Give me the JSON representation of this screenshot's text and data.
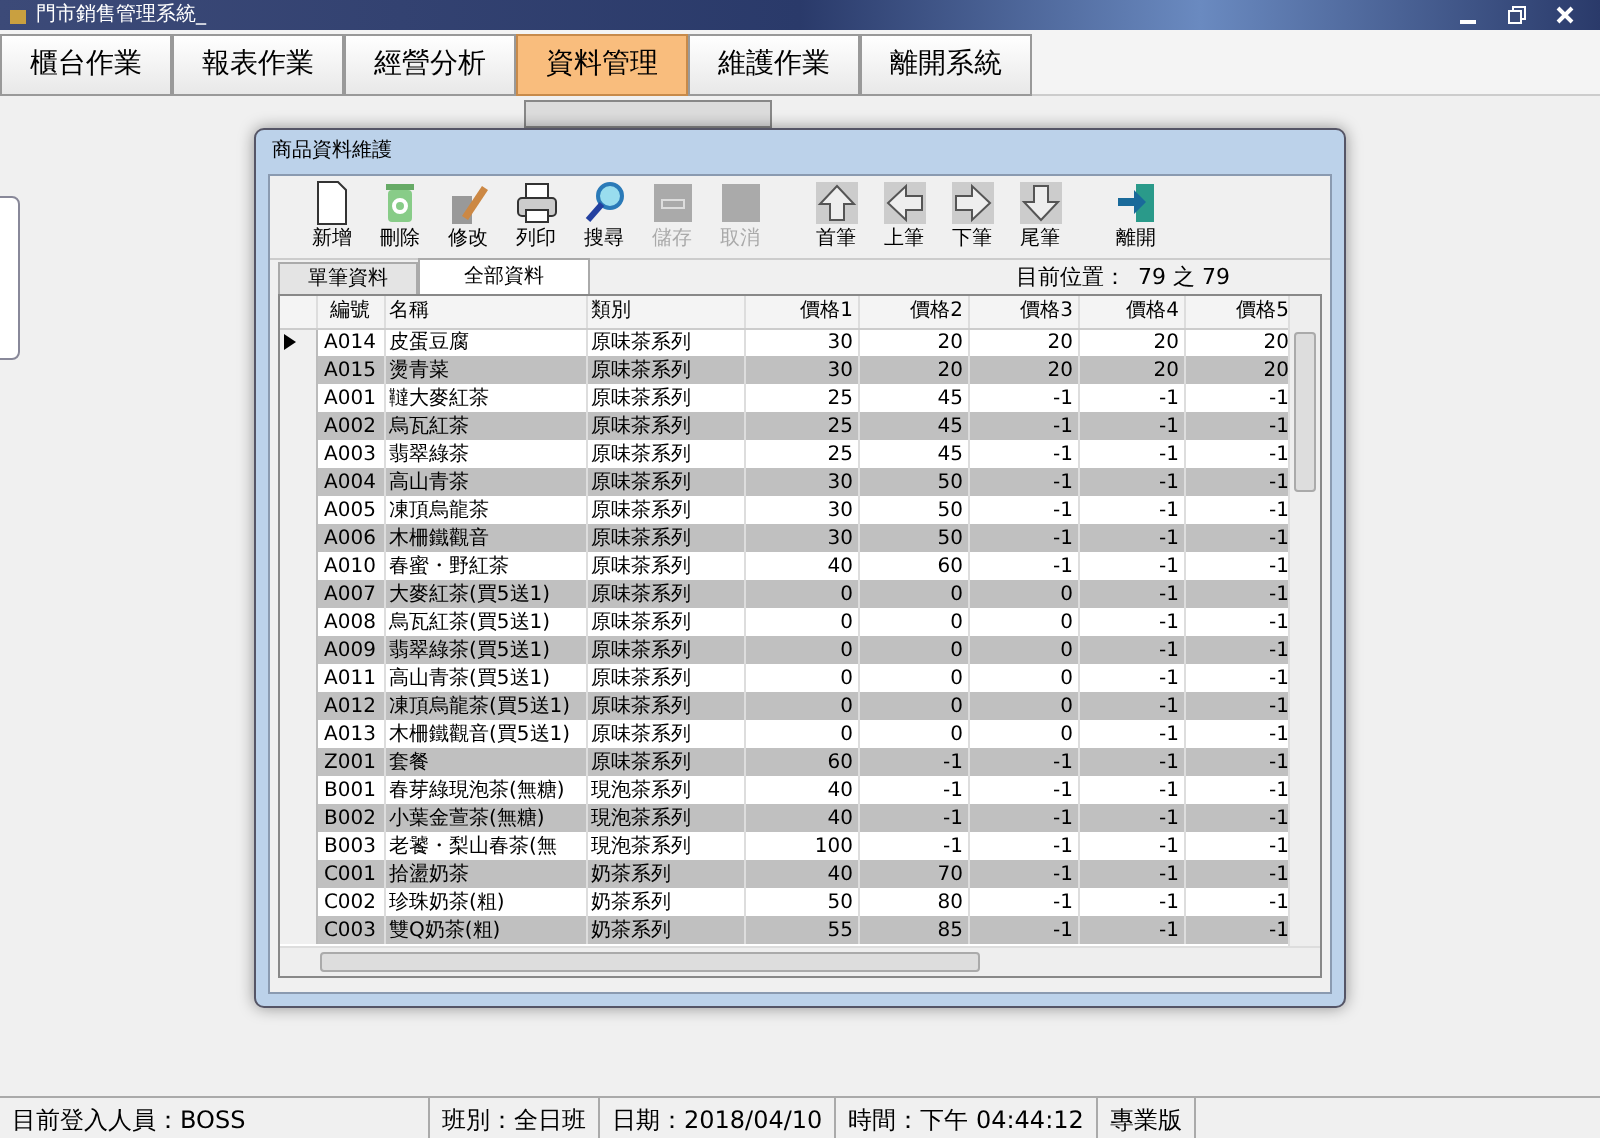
{
  "window": {
    "title": "門市銷售管理系統_"
  },
  "menu": [
    {
      "label": "櫃台作業",
      "selected": false
    },
    {
      "label": "報表作業",
      "selected": false
    },
    {
      "label": "經營分析",
      "selected": false
    },
    {
      "label": "資料管理",
      "selected": true
    },
    {
      "label": "維護作業",
      "selected": false
    },
    {
      "label": "離開系統",
      "selected": false
    }
  ],
  "dialog": {
    "title": "商品資料維護",
    "toolbar": [
      {
        "label": "新增",
        "kind": "new",
        "disabled": false
      },
      {
        "label": "刪除",
        "kind": "delete",
        "disabled": false
      },
      {
        "label": "修改",
        "kind": "edit",
        "disabled": false
      },
      {
        "label": "列印",
        "kind": "print",
        "disabled": false
      },
      {
        "label": "搜尋",
        "kind": "search",
        "disabled": false
      },
      {
        "label": "儲存",
        "kind": "save",
        "disabled": true
      },
      {
        "label": "取消",
        "kind": "cancel",
        "disabled": true
      },
      {
        "label": "首筆",
        "kind": "up",
        "disabled": false
      },
      {
        "label": "上筆",
        "kind": "left",
        "disabled": false
      },
      {
        "label": "下筆",
        "kind": "right",
        "disabled": false
      },
      {
        "label": "尾筆",
        "kind": "down",
        "disabled": false
      },
      {
        "label": "離開",
        "kind": "exit",
        "disabled": false
      }
    ],
    "tabs": [
      {
        "label": "單筆資料",
        "selected": false
      },
      {
        "label": "全部資料",
        "selected": true
      }
    ],
    "position_label": "目前位置：",
    "position": "79 之 79",
    "table": {
      "columns": [
        "編號",
        "名稱",
        "類別",
        "價格1",
        "價格2",
        "價格3",
        "價格4",
        "價格5"
      ],
      "rows": [
        {
          "selected": true,
          "cells": [
            "A014",
            "皮蛋豆腐",
            "原味茶系列",
            "30",
            "20",
            "20",
            "20",
            "20"
          ]
        },
        {
          "selected": false,
          "cells": [
            "A015",
            "燙青菜",
            "原味茶系列",
            "30",
            "20",
            "20",
            "20",
            "20"
          ]
        },
        {
          "selected": false,
          "cells": [
            "A001",
            "韃大麥紅茶",
            "原味茶系列",
            "25",
            "45",
            "-1",
            "-1",
            "-1"
          ]
        },
        {
          "selected": false,
          "cells": [
            "A002",
            "烏瓦紅茶",
            "原味茶系列",
            "25",
            "45",
            "-1",
            "-1",
            "-1"
          ]
        },
        {
          "selected": false,
          "cells": [
            "A003",
            "翡翠綠茶",
            "原味茶系列",
            "25",
            "45",
            "-1",
            "-1",
            "-1"
          ]
        },
        {
          "selected": false,
          "cells": [
            "A004",
            "高山青茶",
            "原味茶系列",
            "30",
            "50",
            "-1",
            "-1",
            "-1"
          ]
        },
        {
          "selected": false,
          "cells": [
            "A005",
            "凍頂烏龍茶",
            "原味茶系列",
            "30",
            "50",
            "-1",
            "-1",
            "-1"
          ]
        },
        {
          "selected": false,
          "cells": [
            "A006",
            "木柵鐵觀音",
            "原味茶系列",
            "30",
            "50",
            "-1",
            "-1",
            "-1"
          ]
        },
        {
          "selected": false,
          "cells": [
            "A010",
            "春蜜・野紅茶",
            "原味茶系列",
            "40",
            "60",
            "-1",
            "-1",
            "-1"
          ]
        },
        {
          "selected": false,
          "cells": [
            "A007",
            "大麥紅茶(買5送1)",
            "原味茶系列",
            "0",
            "0",
            "0",
            "-1",
            "-1"
          ]
        },
        {
          "selected": false,
          "cells": [
            "A008",
            "烏瓦紅茶(買5送1)",
            "原味茶系列",
            "0",
            "0",
            "0",
            "-1",
            "-1"
          ]
        },
        {
          "selected": false,
          "cells": [
            "A009",
            "翡翠綠茶(買5送1)",
            "原味茶系列",
            "0",
            "0",
            "0",
            "-1",
            "-1"
          ]
        },
        {
          "selected": false,
          "cells": [
            "A011",
            "高山青茶(買5送1)",
            "原味茶系列",
            "0",
            "0",
            "0",
            "-1",
            "-1"
          ]
        },
        {
          "selected": false,
          "cells": [
            "A012",
            "凍頂烏龍茶(買5送1)",
            "原味茶系列",
            "0",
            "0",
            "0",
            "-1",
            "-1"
          ]
        },
        {
          "selected": false,
          "cells": [
            "A013",
            "木柵鐵觀音(買5送1)",
            "原味茶系列",
            "0",
            "0",
            "0",
            "-1",
            "-1"
          ]
        },
        {
          "selected": false,
          "cells": [
            "Z001",
            "套餐",
            "原味茶系列",
            "60",
            "-1",
            "-1",
            "-1",
            "-1"
          ]
        },
        {
          "selected": false,
          "cells": [
            "B001",
            "春芽綠現泡茶(無糖)",
            "現泡茶系列",
            "40",
            "-1",
            "-1",
            "-1",
            "-1"
          ]
        },
        {
          "selected": false,
          "cells": [
            "B002",
            "小葉金萱茶(無糖)",
            "現泡茶系列",
            "40",
            "-1",
            "-1",
            "-1",
            "-1"
          ]
        },
        {
          "selected": false,
          "cells": [
            "B003",
            "老饕・梨山春茶(無",
            "現泡茶系列",
            "100",
            "-1",
            "-1",
            "-1",
            "-1"
          ]
        },
        {
          "selected": false,
          "cells": [
            "C001",
            "拾盪奶茶",
            "奶茶系列",
            "40",
            "70",
            "-1",
            "-1",
            "-1"
          ]
        },
        {
          "selected": false,
          "cells": [
            "C002",
            "珍珠奶茶(粗)",
            "奶茶系列",
            "50",
            "80",
            "-1",
            "-1",
            "-1"
          ]
        },
        {
          "selected": false,
          "cells": [
            "C003",
            "雙Q奶茶(粗)",
            "奶茶系列",
            "55",
            "85",
            "-1",
            "-1",
            "-1"
          ]
        }
      ]
    }
  },
  "status_bar": [
    "目前登入人員：BOSS",
    "班別：全日班",
    "日期：2018/04/10",
    "時間：下午 04:44:12",
    "專業版"
  ]
}
